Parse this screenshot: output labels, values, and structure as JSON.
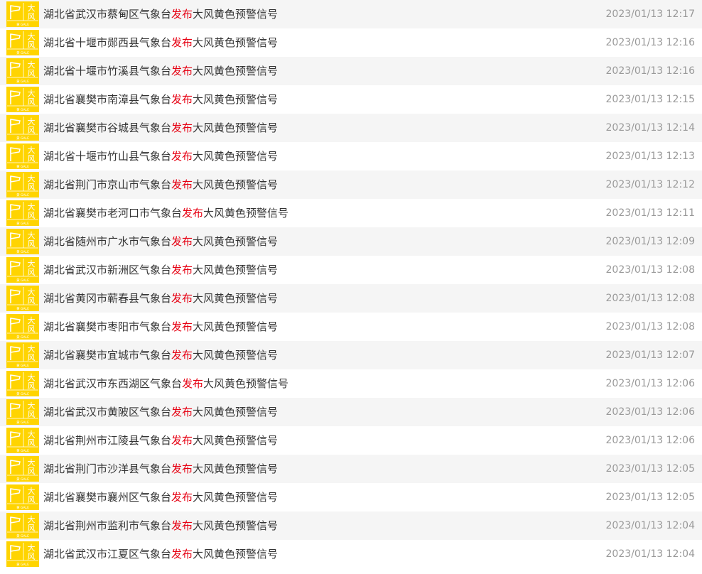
{
  "icon": {
    "name": "gale-yellow-warning-icon",
    "chars": [
      "大",
      "风"
    ],
    "footer": "黄 GALE",
    "color": "#ffd400"
  },
  "warnings": [
    {
      "pre": "湖北省武汉市蔡甸区气象台",
      "verb": "发布",
      "post": "大风黄色预警信号",
      "time": "2023/01/13 12:17"
    },
    {
      "pre": "湖北省十堰市郧西县气象台",
      "verb": "发布",
      "post": "大风黄色预警信号",
      "time": "2023/01/13 12:16"
    },
    {
      "pre": "湖北省十堰市竹溪县气象台",
      "verb": "发布",
      "post": "大风黄色预警信号",
      "time": "2023/01/13 12:16"
    },
    {
      "pre": "湖北省襄樊市南漳县气象台",
      "verb": "发布",
      "post": "大风黄色预警信号",
      "time": "2023/01/13 12:15"
    },
    {
      "pre": "湖北省襄樊市谷城县气象台",
      "verb": "发布",
      "post": "大风黄色预警信号",
      "time": "2023/01/13 12:14"
    },
    {
      "pre": "湖北省十堰市竹山县气象台",
      "verb": "发布",
      "post": "大风黄色预警信号",
      "time": "2023/01/13 12:13"
    },
    {
      "pre": "湖北省荆门市京山市气象台",
      "verb": "发布",
      "post": "大风黄色预警信号",
      "time": "2023/01/13 12:12"
    },
    {
      "pre": "湖北省襄樊市老河口市气象台",
      "verb": "发布",
      "post": "大风黄色预警信号",
      "time": "2023/01/13 12:11"
    },
    {
      "pre": "湖北省随州市广水市气象台",
      "verb": "发布",
      "post": "大风黄色预警信号",
      "time": "2023/01/13 12:09"
    },
    {
      "pre": "湖北省武汉市新洲区气象台",
      "verb": "发布",
      "post": "大风黄色预警信号",
      "time": "2023/01/13 12:08"
    },
    {
      "pre": "湖北省黄冈市蕲春县气象台",
      "verb": "发布",
      "post": "大风黄色预警信号",
      "time": "2023/01/13 12:08"
    },
    {
      "pre": "湖北省襄樊市枣阳市气象台",
      "verb": "发布",
      "post": "大风黄色预警信号",
      "time": "2023/01/13 12:08"
    },
    {
      "pre": "湖北省襄樊市宜城市气象台",
      "verb": "发布",
      "post": "大风黄色预警信号",
      "time": "2023/01/13 12:07"
    },
    {
      "pre": "湖北省武汉市东西湖区气象台",
      "verb": "发布",
      "post": "大风黄色预警信号",
      "time": "2023/01/13 12:06"
    },
    {
      "pre": "湖北省武汉市黄陂区气象台",
      "verb": "发布",
      "post": "大风黄色预警信号",
      "time": "2023/01/13 12:06"
    },
    {
      "pre": "湖北省荆州市江陵县气象台",
      "verb": "发布",
      "post": "大风黄色预警信号",
      "time": "2023/01/13 12:06"
    },
    {
      "pre": "湖北省荆门市沙洋县气象台",
      "verb": "发布",
      "post": "大风黄色预警信号",
      "time": "2023/01/13 12:05"
    },
    {
      "pre": "湖北省襄樊市襄州区气象台",
      "verb": "发布",
      "post": "大风黄色预警信号",
      "time": "2023/01/13 12:05"
    },
    {
      "pre": "湖北省荆州市监利市气象台",
      "verb": "发布",
      "post": "大风黄色预警信号",
      "time": "2023/01/13 12:04"
    },
    {
      "pre": "湖北省武汉市江夏区气象台",
      "verb": "发布",
      "post": "大风黄色预警信号",
      "time": "2023/01/13 12:04"
    }
  ]
}
